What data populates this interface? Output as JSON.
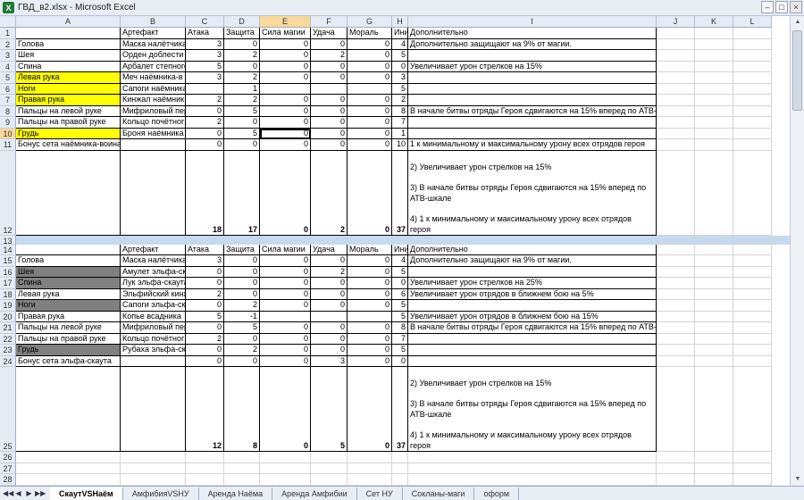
{
  "window": {
    "title": "ГВД_в2.xlsx - Microsoft Excel",
    "app_icon": "X",
    "minimize": "–",
    "maximize": "□",
    "close": "×"
  },
  "columns": [
    "A",
    "B",
    "C",
    "D",
    "E",
    "F",
    "G",
    "H",
    "I",
    "J",
    "K",
    "L"
  ],
  "selected_column": "E",
  "selected_row": "10",
  "section1": {
    "header": {
      "b": "Артефакт",
      "c": "Атака",
      "d": "Защита",
      "e": "Сила магии",
      "f": "Удача",
      "g": "Мораль",
      "h": "Инициатива",
      "i": "Дополнительно"
    },
    "rows": [
      {
        "num": "2",
        "a": "Голова",
        "b": "Маска налётчика",
        "c": "3",
        "d": "0",
        "e": "0",
        "f": "0",
        "g": "0",
        "h": "4",
        "i": "Дополнительно защищают на 9% от магии."
      },
      {
        "num": "3",
        "a": "Шея",
        "b": "Орден доблести",
        "c": "3",
        "d": "2",
        "e": "0",
        "f": "2",
        "g": "0",
        "h": "5",
        "i": ""
      },
      {
        "num": "4",
        "a": "Спина",
        "b": "Арбалет степного",
        "c": "5",
        "d": "0",
        "e": "0",
        "f": "0",
        "g": "0",
        "h": "0",
        "i": "Увеличивает урон стрелков на 15%"
      },
      {
        "num": "5",
        "a": "Левая рука",
        "b": "Меч наёмника-в",
        "c": "3",
        "d": "2",
        "e": "0",
        "f": "0",
        "g": "0",
        "h": "3",
        "i": ""
      },
      {
        "num": "6",
        "a": "Ноги",
        "b": "Сапоги наёмника-воина",
        "c": "",
        "d": "1",
        "e": "",
        "f": "",
        "g": "",
        "h": "5",
        "i": ""
      },
      {
        "num": "7",
        "a": "Правая рука",
        "b": "Кинжал наёмник",
        "c": "2",
        "d": "2",
        "e": "0",
        "f": "0",
        "g": "0",
        "h": "2",
        "i": ""
      },
      {
        "num": "8",
        "a": "Пальцы на левой руке",
        "b": "Мифриловый пер",
        "c": "0",
        "d": "5",
        "e": "0",
        "f": "0",
        "g": "0",
        "h": "8",
        "i": "В начале битвы отряды Героя сдвигаются на 15% вперед по АТВ-шкале"
      },
      {
        "num": "9",
        "a": "Пальцы на правой руке",
        "b": "Кольцо почётног",
        "c": "2",
        "d": "0",
        "e": "0",
        "f": "0",
        "g": "0",
        "h": "7",
        "i": ""
      },
      {
        "num": "10",
        "a": "Грудь",
        "b": "Броня наёмника",
        "c": "0",
        "d": "5",
        "e": "0",
        "f": "0",
        "g": "0",
        "h": "1",
        "i": ""
      },
      {
        "num": "11",
        "a": "Бонус сета наёмника-воина",
        "b": "",
        "c": "0",
        "d": "0",
        "e": "0",
        "f": "0",
        "g": "0",
        "h": "10",
        "i": "1 к минимальному и максимальному урону всех отрядов героя"
      }
    ],
    "total": {
      "num": "12",
      "c": "18",
      "d": "17",
      "e": "0",
      "f": "2",
      "g": "0",
      "h": "37",
      "notes": [
        "2) Увеличивает урон стрелков на 15%",
        "3) В начале битвы отряды Героя сдвигаются на 15% вперед по АТВ-шкале",
        "4) 1 к минимальному и максимальному урону всех отрядов героя"
      ]
    }
  },
  "section2": {
    "header": {
      "b": "Артефакт",
      "c": "Атака",
      "d": "Защита",
      "e": "Сила магии",
      "f": "Удача",
      "g": "Мораль",
      "h": "Инициатива",
      "i": "Дополнительно"
    },
    "rows": [
      {
        "num": "15",
        "a": "Голова",
        "b": "Маска налётчика",
        "c": "3",
        "d": "0",
        "e": "0",
        "f": "0",
        "g": "0",
        "h": "4",
        "i": "Дополнительно защищают на 9% от магии."
      },
      {
        "num": "16",
        "a": "Шея",
        "b": "Амулет эльфа-ск",
        "c": "0",
        "d": "0",
        "e": "0",
        "f": "2",
        "g": "0",
        "h": "5",
        "i": ""
      },
      {
        "num": "17",
        "a": "Спина",
        "b": "Лук эльфа-скаута",
        "c": "0",
        "d": "0",
        "e": "0",
        "f": "0",
        "g": "0",
        "h": "0",
        "i": "Увеличивает урон стрелков на 25%"
      },
      {
        "num": "18",
        "a": "Левая рука",
        "b": "Эльфийский кинж",
        "c": "2",
        "d": "0",
        "e": "0",
        "f": "0",
        "g": "0",
        "h": "6",
        "i": "Увеличивает урон отрядов в ближнем бою на 5%"
      },
      {
        "num": "19",
        "a": "Ноги",
        "b": "Сапоги эльфа-ска",
        "c": "0",
        "d": "2",
        "e": "0",
        "f": "0",
        "g": "0",
        "h": "5",
        "i": ""
      },
      {
        "num": "20",
        "a": "Правая рука",
        "b": "Копье всадника",
        "c": "5",
        "d": "-1",
        "e": "",
        "f": "",
        "g": "",
        "h": "5",
        "i": "Увеличивает урон отрядов в ближнем бою на 15%"
      },
      {
        "num": "21",
        "a": "Пальцы на левой руке",
        "b": "Мифриловый пер",
        "c": "0",
        "d": "5",
        "e": "0",
        "f": "0",
        "g": "0",
        "h": "8",
        "i": "В начале битвы отряды Героя сдвигаются на 15% вперед по АТВ-шкале"
      },
      {
        "num": "22",
        "a": "Пальцы на правой руке",
        "b": "Кольцо почётног",
        "c": "2",
        "d": "0",
        "e": "0",
        "f": "0",
        "g": "0",
        "h": "7",
        "i": ""
      },
      {
        "num": "23",
        "a": "Грудь",
        "b": "Рубаха эльфа-ска",
        "c": "0",
        "d": "2",
        "e": "0",
        "f": "0",
        "g": "0",
        "h": "5",
        "i": ""
      },
      {
        "num": "24",
        "a": "Бонус сета эльфа-скаута",
        "b": "",
        "c": "0",
        "d": "0",
        "e": "0",
        "f": "3",
        "g": "0",
        "h": "0",
        "i": ""
      }
    ],
    "total": {
      "num": "25",
      "c": "12",
      "d": "8",
      "e": "0",
      "f": "5",
      "g": "0",
      "h": "37",
      "notes": [
        "2) Увеличивает урон стрелков на 15%",
        "3) В начале битвы отряды Героя сдвигаются на 15% вперед по АТВ-шкале",
        "4) 1 к минимальному и максимальному урону всех отрядов героя"
      ]
    }
  },
  "tabs": [
    "СкаутVSНаём",
    "АмфибияVSНУ",
    "Аренда Наёма",
    "Аренда Амфибии",
    "Сет НУ",
    "Сокланы-маги",
    "оформ"
  ],
  "active_tab": "СкаутVSНаём",
  "tab_nav": [
    "◀◀",
    "◀",
    "▶",
    "▶▶"
  ],
  "highlight_colors": {
    "yellow": "#ffff00",
    "gray": "#808080",
    "separator": "#c6d9f0"
  }
}
